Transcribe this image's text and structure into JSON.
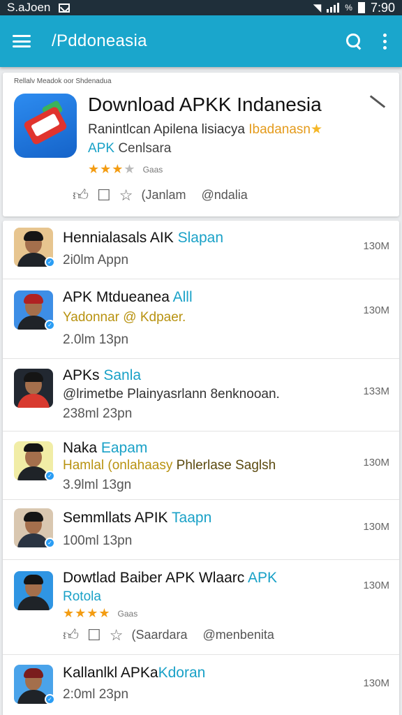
{
  "status_bar": {
    "carrier": "S.aJoen",
    "battery_pct": "%",
    "time": "7:90"
  },
  "app_bar": {
    "title": "/Pddoneasia"
  },
  "featured": {
    "caption": "Rellalv Meadok oor Shdenadua",
    "title": "Download APKK Indanesia",
    "subtitle": "Ranintlcan Apilena lisiacya",
    "subtitle_highlight": "Ibadanasn",
    "developer_prefix": "APK",
    "developer_name": "Cenlsara",
    "rating_text": "Gaas",
    "stars": "★★★",
    "stars_empty": "★",
    "action_1": "(Janlam",
    "action_2": "@ndalia"
  },
  "list": [
    {
      "title": "Hennialasals AIK",
      "title_highlight": "Slapan",
      "meta": "2i0lm Appn",
      "size": "130M"
    },
    {
      "title": "APK Mtdueanea",
      "title_highlight": "Alll",
      "detail": "Yadonnar @ Kdpaer.",
      "meta": "2.0lm 13pn",
      "size": "130M"
    },
    {
      "title": "APKs",
      "title_highlight": "Sanla",
      "detail": "@lrimetbe Plainyasrlann 8enknooan.",
      "meta": "238ml 23pn",
      "size": "133M"
    },
    {
      "title": "Naka",
      "title_highlight": "Eapam",
      "detail": "Hamlal (onlahaasy",
      "detail_dark": "Phlerlase Saglsh",
      "meta": "3.9lml 13gn",
      "size": "130M"
    },
    {
      "title": "Semmllats APIK",
      "title_highlight": "Taapn",
      "meta": "100ml 13pn",
      "size": "130M"
    },
    {
      "title": "Dowtlad Baiber APK Wlaarc",
      "title_highlight": "APK",
      "detail_teal": "Rotola",
      "stars": "★★★★",
      "rating_text": "Gaas",
      "action_1": "(Saardara",
      "action_2": "@menbenita",
      "size": "130M"
    },
    {
      "title": "Kallanlkl APKa",
      "title_highlight": "Kdoran",
      "meta": "2:0ml 23pn",
      "size": "130M"
    }
  ]
}
